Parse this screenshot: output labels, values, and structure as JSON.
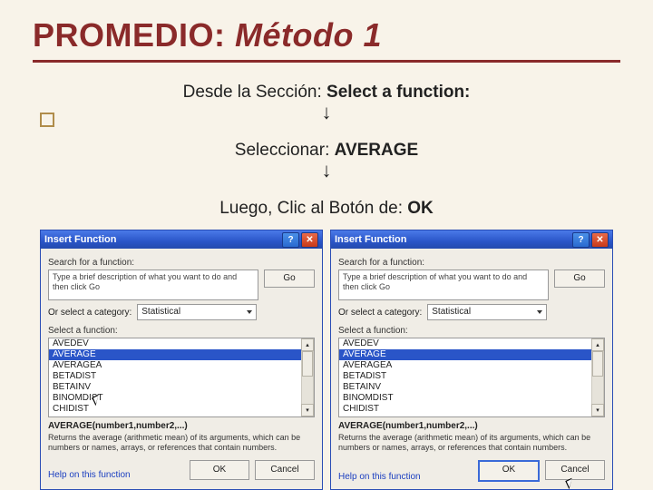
{
  "title_roman": "PROMEDIO: ",
  "title_italic": "Método 1",
  "line1_a": "Desde la Sección: ",
  "line1_b": "Select a function:",
  "line2_a": "Seleccionar: ",
  "line2_b": "AVERAGE",
  "line3_a": "Luego, Clic al Botón de: ",
  "line3_b": "OK",
  "arrow": "↓",
  "dlg": {
    "title": "Insert Function",
    "help_btn": "?",
    "close_btn": "✕",
    "search_lbl": "Search for a function:",
    "search_text": "Type a brief description of what you want to do and then click Go",
    "go": "Go",
    "cat_lbl": "Or select a category:",
    "cat_val": "Statistical",
    "sel_lbl": "Select a function:",
    "funcs": [
      "AVEDEV",
      "AVERAGE",
      "AVERAGEA",
      "BETADIST",
      "BETAINV",
      "BINOMDIST",
      "CHIDIST"
    ],
    "signature": "AVERAGE(number1,number2,...)",
    "desc": "Returns the average (arithmetic mean) of its arguments, which can be numbers or names, arrays, or references that contain numbers.",
    "helplink": "Help on this function",
    "ok": "OK",
    "cancel": "Cancel",
    "scroll_up": "▴",
    "scroll_dn": "▾"
  }
}
